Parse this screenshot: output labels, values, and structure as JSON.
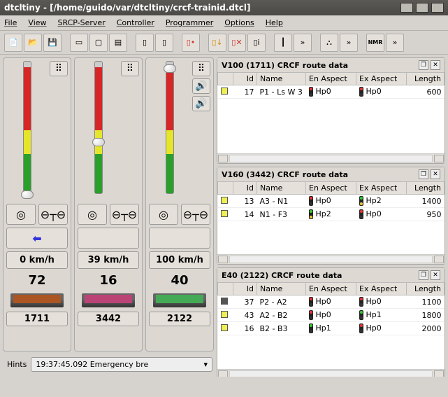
{
  "window": {
    "title": "dtcltiny - [/home/guido/var/dtcltiny/crcf-trainid.dtcl]"
  },
  "menu": {
    "file": "File",
    "view": "View",
    "srcp": "SRCP-Server",
    "controller": "Controller",
    "programmer": "Programmer",
    "options": "Options",
    "help": "Help"
  },
  "throttles": [
    {
      "speed": "0 km/h",
      "addr": "72",
      "id": "1711",
      "dir": "⬅",
      "knob_pct": 98,
      "loco_class": "red"
    },
    {
      "speed": "39 km/h",
      "addr": "16",
      "id": "3442",
      "dir": "",
      "knob_pct": 58,
      "loco_class": "pink"
    },
    {
      "speed": "100 km/h",
      "addr": "40",
      "id": "2122",
      "dir": "",
      "knob_pct": 2,
      "loco_class": "green"
    }
  ],
  "hints": {
    "label": "Hints",
    "combo": "19:37:45.092 Emergency bre"
  },
  "panels": [
    {
      "title": "V100 (1711) CRCF route data",
      "cols": [
        "",
        "Id",
        "Name",
        "En Aspect",
        "Ex Aspect",
        "Length"
      ],
      "rows": [
        {
          "sq": "",
          "id": "17",
          "name": "P1 - Ls W 3",
          "en": "Hp0",
          "en_sig": "hp0",
          "ex": "Hp0",
          "ex_sig": "hp0",
          "len": "600"
        }
      ]
    },
    {
      "title": "V160 (3442) CRCF route data",
      "cols": [
        "",
        "Id",
        "Name",
        "En Aspect",
        "Ex Aspect",
        "Length"
      ],
      "rows": [
        {
          "sq": "",
          "id": "13",
          "name": "A3 - N1",
          "en": "Hp0",
          "en_sig": "hp0",
          "ex": "Hp2",
          "ex_sig": "hp2",
          "len": "1400"
        },
        {
          "sq": "",
          "id": "14",
          "name": "N1 - F3",
          "en": "Hp2",
          "en_sig": "hp2",
          "ex": "Hp0",
          "ex_sig": "hp0",
          "len": "950"
        }
      ]
    },
    {
      "title": "E40 (2122) CRCF route data",
      "cols": [
        "",
        "Id",
        "Name",
        "En Aspect",
        "Ex Aspect",
        "Length"
      ],
      "rows": [
        {
          "sq": "dark",
          "id": "37",
          "name": "P2 - A2",
          "en": "Hp0",
          "en_sig": "hp0",
          "ex": "Hp0",
          "ex_sig": "hp0",
          "len": "1100"
        },
        {
          "sq": "",
          "id": "43",
          "name": "A2 - B2",
          "en": "Hp0",
          "en_sig": "hp0",
          "ex": "Hp1",
          "ex_sig": "hp1",
          "len": "1800"
        },
        {
          "sq": "",
          "id": "16",
          "name": "B2 - B3",
          "en": "Hp1",
          "en_sig": "hp1",
          "ex": "Hp0",
          "ex_sig": "hp0",
          "len": "2000"
        }
      ]
    }
  ]
}
